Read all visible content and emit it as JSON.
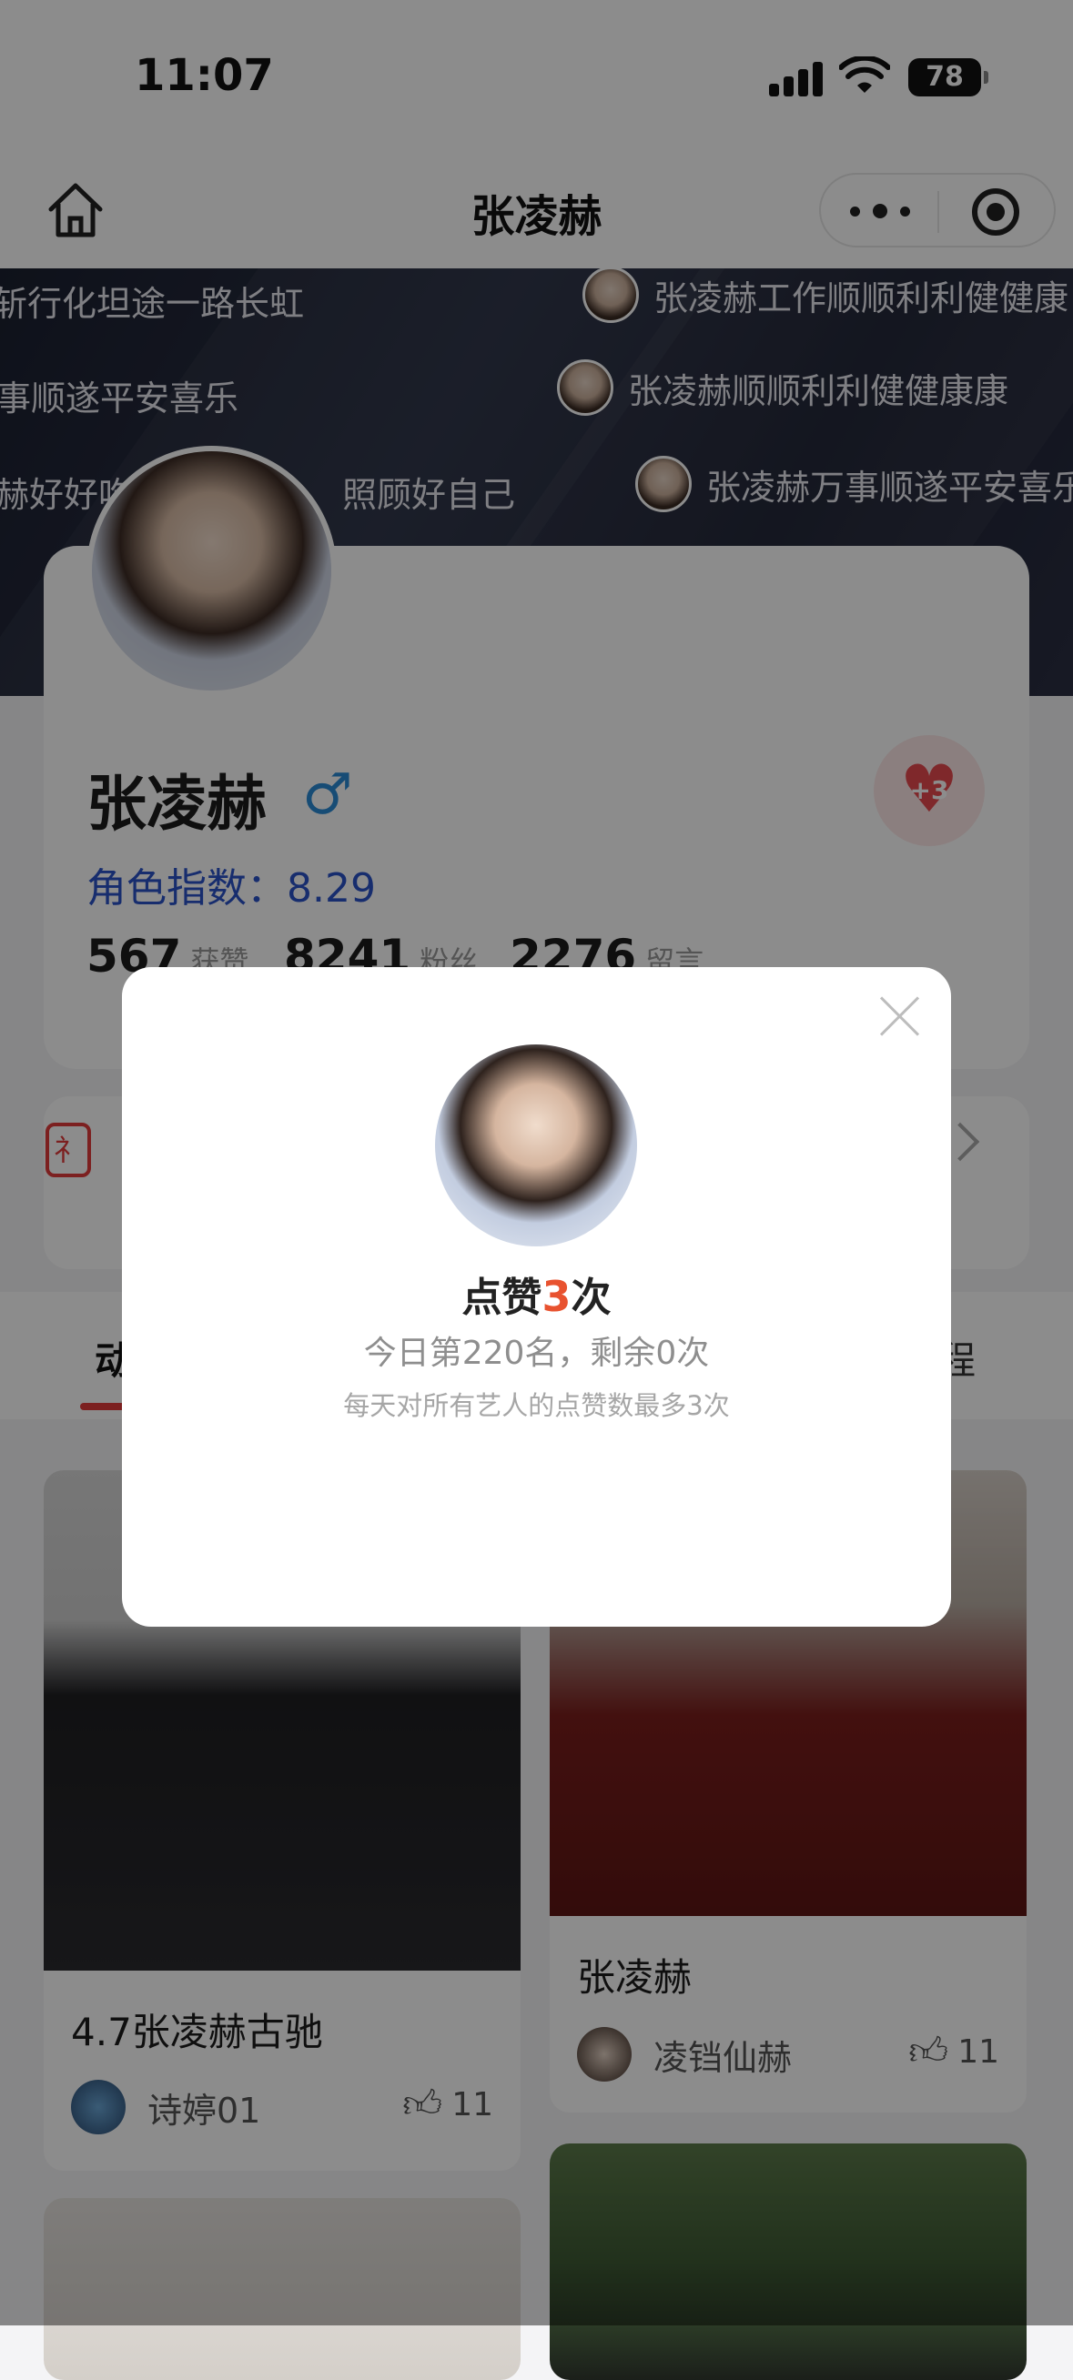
{
  "status_bar": {
    "time": "11:07",
    "battery": "78"
  },
  "nav": {
    "title": "张凌赫",
    "icons": [
      "home-icon",
      "more-dots-icon",
      "target-icon"
    ]
  },
  "banner": {
    "messages": [
      "斩行化坦途一路长虹",
      "张凌赫工作顺顺利利健健康",
      "事顺遂平安喜乐",
      "张凌赫顺顺利利健健康康",
      "赫好好吃",
      "照顾好自己",
      "张凌赫万事顺遂平安喜乐"
    ]
  },
  "profile": {
    "name": "张凌赫",
    "gender_symbol": "♂",
    "index_label": "角色指数：",
    "index_value": "8.29",
    "heart_count": "+3",
    "stats": [
      {
        "value": "567",
        "label": "获赞"
      },
      {
        "value": "8241",
        "label": "粉丝"
      },
      {
        "value": "2276",
        "label": "留言"
      }
    ]
  },
  "tabs": {
    "first": "动",
    "last": "程"
  },
  "feed": [
    {
      "title": "4.7张凌赫古驰",
      "author": "诗婷01",
      "likes": "11"
    },
    {
      "title": "张凌赫",
      "author": "凌铛仙赫",
      "likes": "11"
    }
  ],
  "modal": {
    "line1_prefix": "点赞",
    "line1_count": "3",
    "line1_suffix": "次",
    "line2": "今日第220名，剩余0次",
    "line3": "每天对所有艺人的点赞数最多3次"
  },
  "colors": {
    "accent_red": "#e23b3b",
    "count_orange": "#e8522f",
    "index_blue": "#2a53c8"
  }
}
